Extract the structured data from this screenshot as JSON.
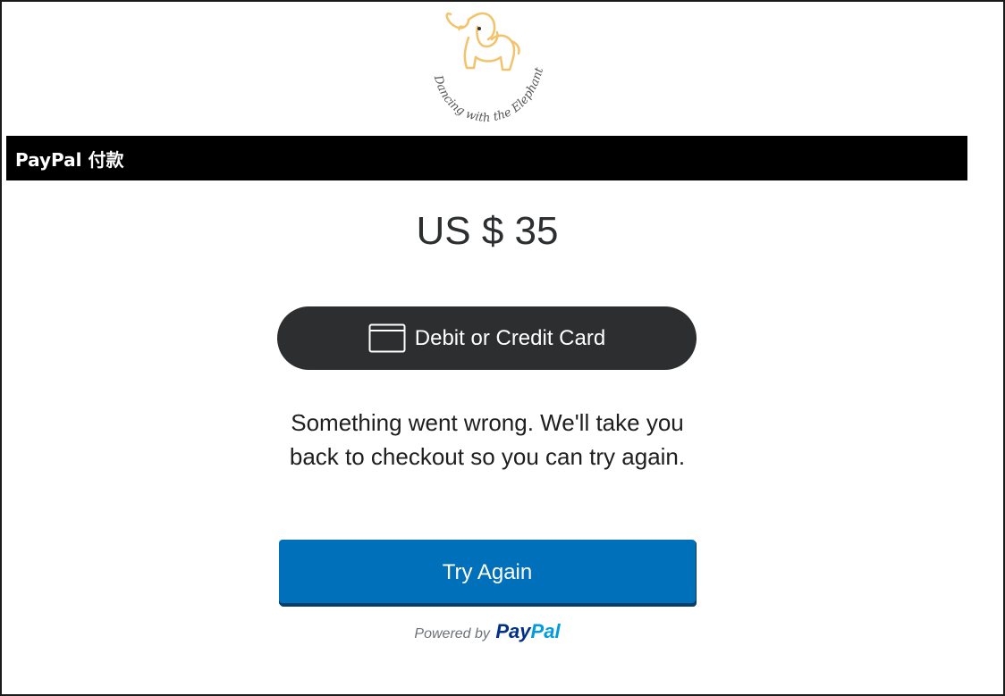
{
  "logo": {
    "icon": "elephant-icon",
    "text": "Dancing with the Elephant",
    "color": "#f2c36a"
  },
  "header": {
    "title": "PayPal 付款"
  },
  "payment": {
    "amount": "US $ 35"
  },
  "card_button": {
    "icon": "credit-card-icon",
    "label": "Debit or Credit Card"
  },
  "error": {
    "message": "Something went wrong. We'll take you back to checkout so you can try again."
  },
  "try_again": {
    "label": "Try Again"
  },
  "footer": {
    "powered_by": "Powered by",
    "brand_pay": "Pay",
    "brand_pal": "Pal"
  },
  "colors": {
    "header_bg": "#000000",
    "card_button_bg": "#2c2e2f",
    "primary_button_bg": "#0070ba",
    "paypal_dark_blue": "#003087",
    "paypal_light_blue": "#009cde"
  }
}
